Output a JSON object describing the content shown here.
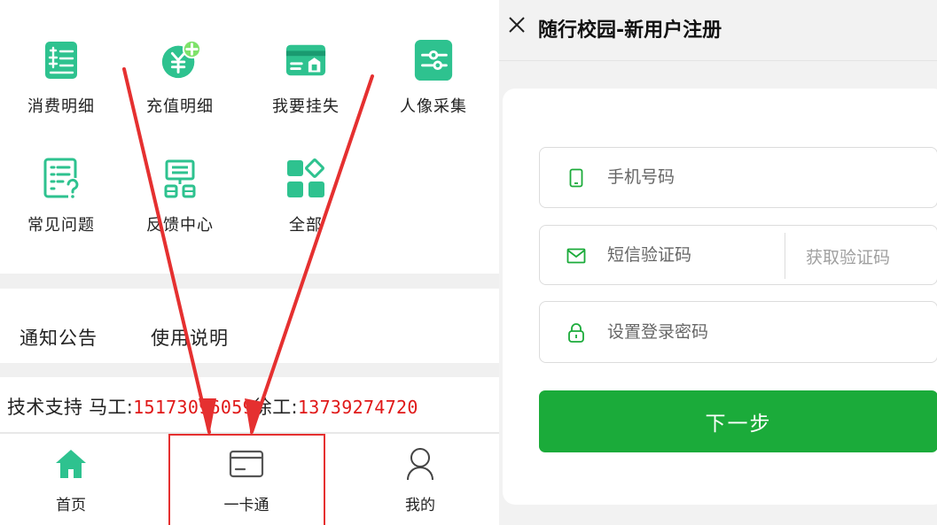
{
  "left_app": {
    "services": [
      {
        "label": "消费明细",
        "icon": "bill-list-icon"
      },
      {
        "label": "充值明细",
        "icon": "yuan-recharge-icon"
      },
      {
        "label": "我要挂失",
        "icon": "card-lock-icon"
      },
      {
        "label": "人像采集",
        "icon": "settings-sliders-icon"
      },
      {
        "label": "常见问题",
        "icon": "faq-document-icon"
      },
      {
        "label": "反馈中心",
        "icon": "feedback-center-icon"
      },
      {
        "label": "全部",
        "icon": "all-apps-icon"
      }
    ],
    "tabs": [
      "通知公告",
      "使用说明"
    ],
    "support": {
      "prefix": "技术支持 马工:",
      "phone1": "15173096059",
      "middle": "徐工:",
      "phone2": "13739274720"
    },
    "bottom_nav": [
      {
        "label": "首页",
        "icon": "home-icon"
      },
      {
        "label": "一卡通",
        "icon": "card-icon"
      },
      {
        "label": "我的",
        "icon": "user-icon"
      }
    ]
  },
  "right_app": {
    "title": "随行校园-新用户注册",
    "phone_placeholder": "手机号码",
    "sms_placeholder": "短信验证码",
    "get_code_label": "获取验证码",
    "password_placeholder": "设置登录密码",
    "next_label": "下一步"
  },
  "colors": {
    "brand_green": "#1bab3a",
    "icon_teal": "#2ec28f",
    "annotation_red": "#e53030",
    "phone_red": "#e01818"
  }
}
